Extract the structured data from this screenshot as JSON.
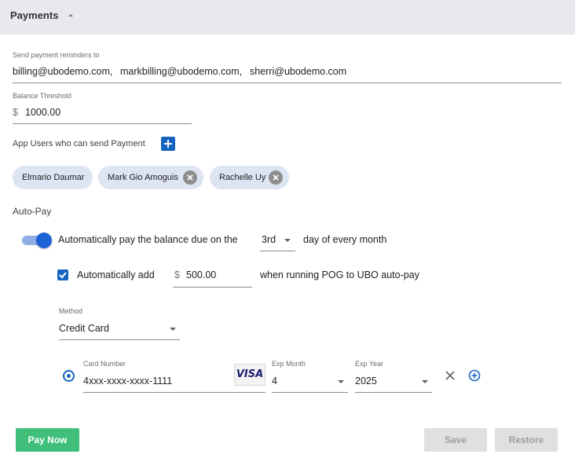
{
  "header": {
    "title": "Payments"
  },
  "reminders": {
    "label": "Send payment reminders to",
    "emails": [
      "billing@ubodemo.com,",
      "markbilling@ubodemo.com,",
      "sherri@ubodemo.com"
    ]
  },
  "threshold": {
    "label": "Balance Threshold",
    "currency": "$",
    "value": "1000.00"
  },
  "app_users": {
    "label": "App Users who can send Payment",
    "chips": [
      "Elmario Daumar",
      "Mark Gio Amoguis",
      "Rachelle Uy"
    ]
  },
  "autopay": {
    "title": "Auto-Pay",
    "toggle_on": true,
    "text_before": "Automatically pay the balance due on the",
    "day_value": "3rd",
    "text_after": "day of every month",
    "auto_add_checked": true,
    "auto_add_label": "Automatically add",
    "amount_currency": "$",
    "amount_value": "500.00",
    "auto_add_suffix": "when running POG to UBO auto-pay"
  },
  "method": {
    "label": "Method",
    "value": "Credit Card"
  },
  "card": {
    "selected": true,
    "number_label": "Card Number",
    "number_value": "4xxx-xxxx-xxxx-1111",
    "brand": "VISA",
    "exp_month_label": "Exp Month",
    "exp_month_value": "4",
    "exp_year_label": "Exp Year",
    "exp_year_value": "2025"
  },
  "buttons": {
    "pay_now": "Pay Now",
    "save": "Save",
    "restore": "Restore"
  },
  "colors": {
    "accent": "#1565c0",
    "pay_green": "#3fbf79",
    "chip_bg": "#dde4f2",
    "header_bg": "#e8e9ec"
  }
}
